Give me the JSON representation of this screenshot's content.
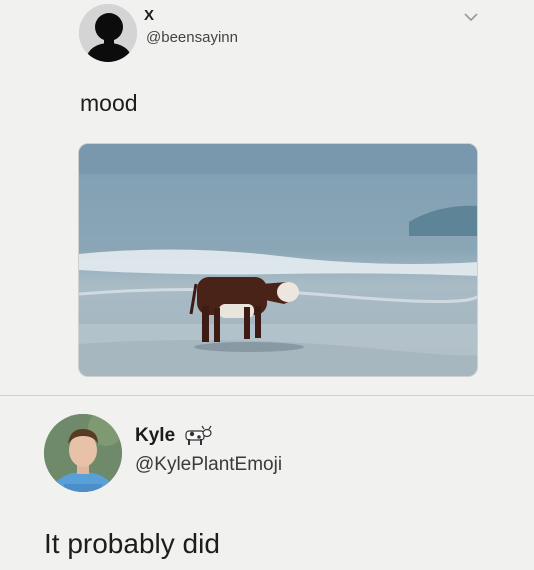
{
  "tweet1": {
    "author_name": "X",
    "handle": "@beensayinn",
    "text": "mood",
    "media_icon": "cow-on-beach-photo"
  },
  "tweet2": {
    "author_name": "Kyle",
    "author_emoji": "cow-icon",
    "handle": "@KylePlantEmoji",
    "text": "It probably did"
  },
  "colors": {
    "background": "#f1f1ef",
    "divider": "#cfcfcf",
    "text": "#1d1d1d"
  }
}
